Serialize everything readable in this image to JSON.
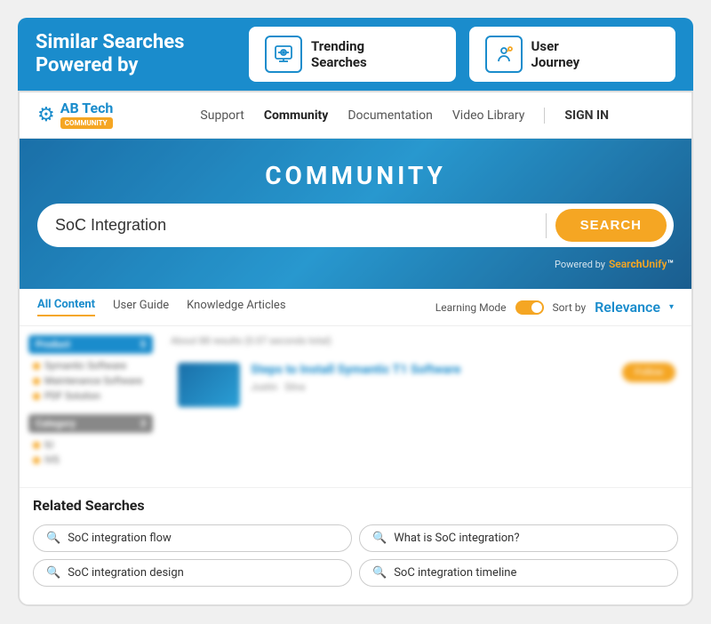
{
  "banner": {
    "title": "Similar Searches\nPowered by",
    "cards": [
      {
        "label": "Trending\nSearches",
        "icon": "trending-icon"
      },
      {
        "label": "User\nJourney",
        "icon": "journey-icon"
      }
    ]
  },
  "nav": {
    "logo_text": "AB Tech",
    "logo_badge": "COMMUNITY",
    "links": [
      "Support",
      "Community",
      "Documentation",
      "Video Library"
    ],
    "active_link": "Community",
    "signin": "SIGN IN"
  },
  "hero": {
    "title": "COMMUNITY",
    "search_value": "SoC Integration",
    "search_button": "SEARCH",
    "powered_by_label": "Powered by",
    "powered_by_brand_pre": "Sear",
    "powered_by_brand_mid": "ch",
    "powered_by_brand_post": "Unify"
  },
  "tabs": {
    "items": [
      "All Content",
      "User Guide",
      "Knowledge Articles"
    ],
    "active": "All Content",
    "learning_mode": "Learning Mode",
    "sort_label": "Sort by",
    "sort_value": "Relevance"
  },
  "results": {
    "count": "About 88 results (0.07 seconds total)",
    "items": [
      {
        "title": "Steps to Install Symantic T1 Software",
        "meta_author": "Justin",
        "meta_tag": "Silva",
        "action": "Follow"
      }
    ]
  },
  "sidebar": {
    "sections": [
      {
        "header": "Product",
        "count": "5",
        "items": [
          "Symantic Software",
          "Maintenance Software",
          "PDF Solution"
        ]
      },
      {
        "header": "Category",
        "count": "3",
        "items": [
          "IU",
          "IVS"
        ]
      }
    ]
  },
  "related": {
    "title": "Related Searches",
    "tags": [
      "SoC integration flow",
      "What is SoC integration?",
      "SoC integration design",
      "SoC integration timeline"
    ]
  },
  "colors": {
    "primary": "#1a8ccc",
    "accent": "#f5a623",
    "banner_bg": "#1a8ccc"
  }
}
